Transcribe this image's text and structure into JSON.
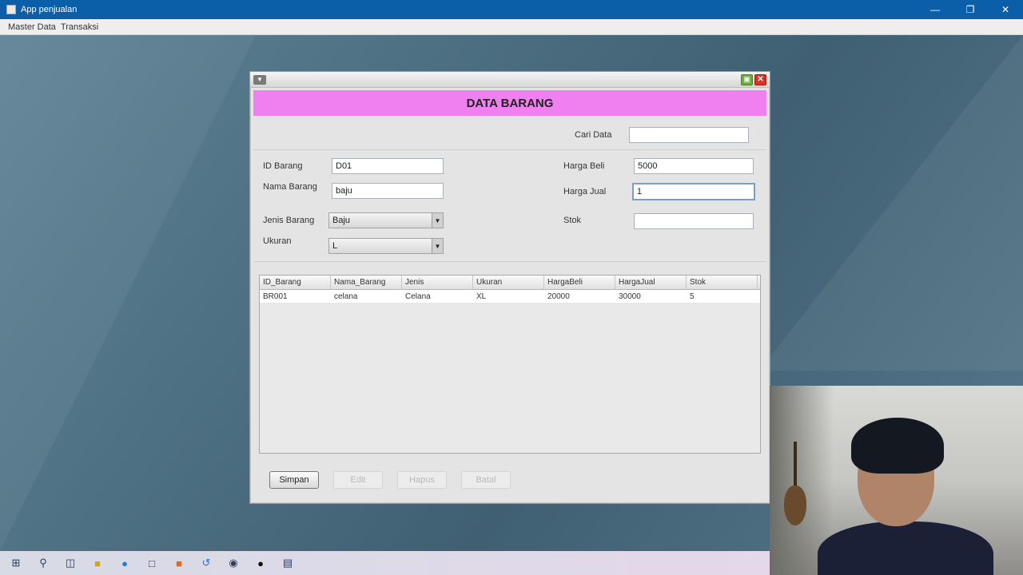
{
  "window": {
    "title": "App penjualan",
    "min": "—",
    "max": "❐",
    "close": "✕"
  },
  "menubar": {
    "items": [
      "Master Data",
      "Transaksi"
    ]
  },
  "form": {
    "title": "DATA BARANG",
    "search": {
      "label": "Cari Data",
      "value": ""
    },
    "id_barang": {
      "label": "ID Barang",
      "value": "D01"
    },
    "nama_barang": {
      "label": "Nama Barang",
      "value": "baju"
    },
    "jenis_barang": {
      "label": "Jenis Barang",
      "value": "Baju"
    },
    "ukuran": {
      "label": "Ukuran",
      "value": "L"
    },
    "harga_beli": {
      "label": "Harga Beli",
      "value": "5000"
    },
    "harga_jual": {
      "label": "Harga Jual",
      "value": "1"
    },
    "stok": {
      "label": "Stok",
      "value": ""
    }
  },
  "table": {
    "columns": [
      "ID_Barang",
      "Nama_Barang",
      "Jenis",
      "Ukuran",
      "HargaBeli",
      "HargaJual",
      "Stok"
    ],
    "rows": [
      [
        "BR001",
        "celana",
        "Celana",
        "XL",
        "20000",
        "30000",
        "5"
      ]
    ]
  },
  "buttons": {
    "save": "Simpan",
    "edit": "Edit",
    "delete": "Hapus",
    "cancel": "Batal"
  },
  "colors": {
    "header_band": "#f07ff0",
    "titlebar": "#0b5ea8"
  }
}
